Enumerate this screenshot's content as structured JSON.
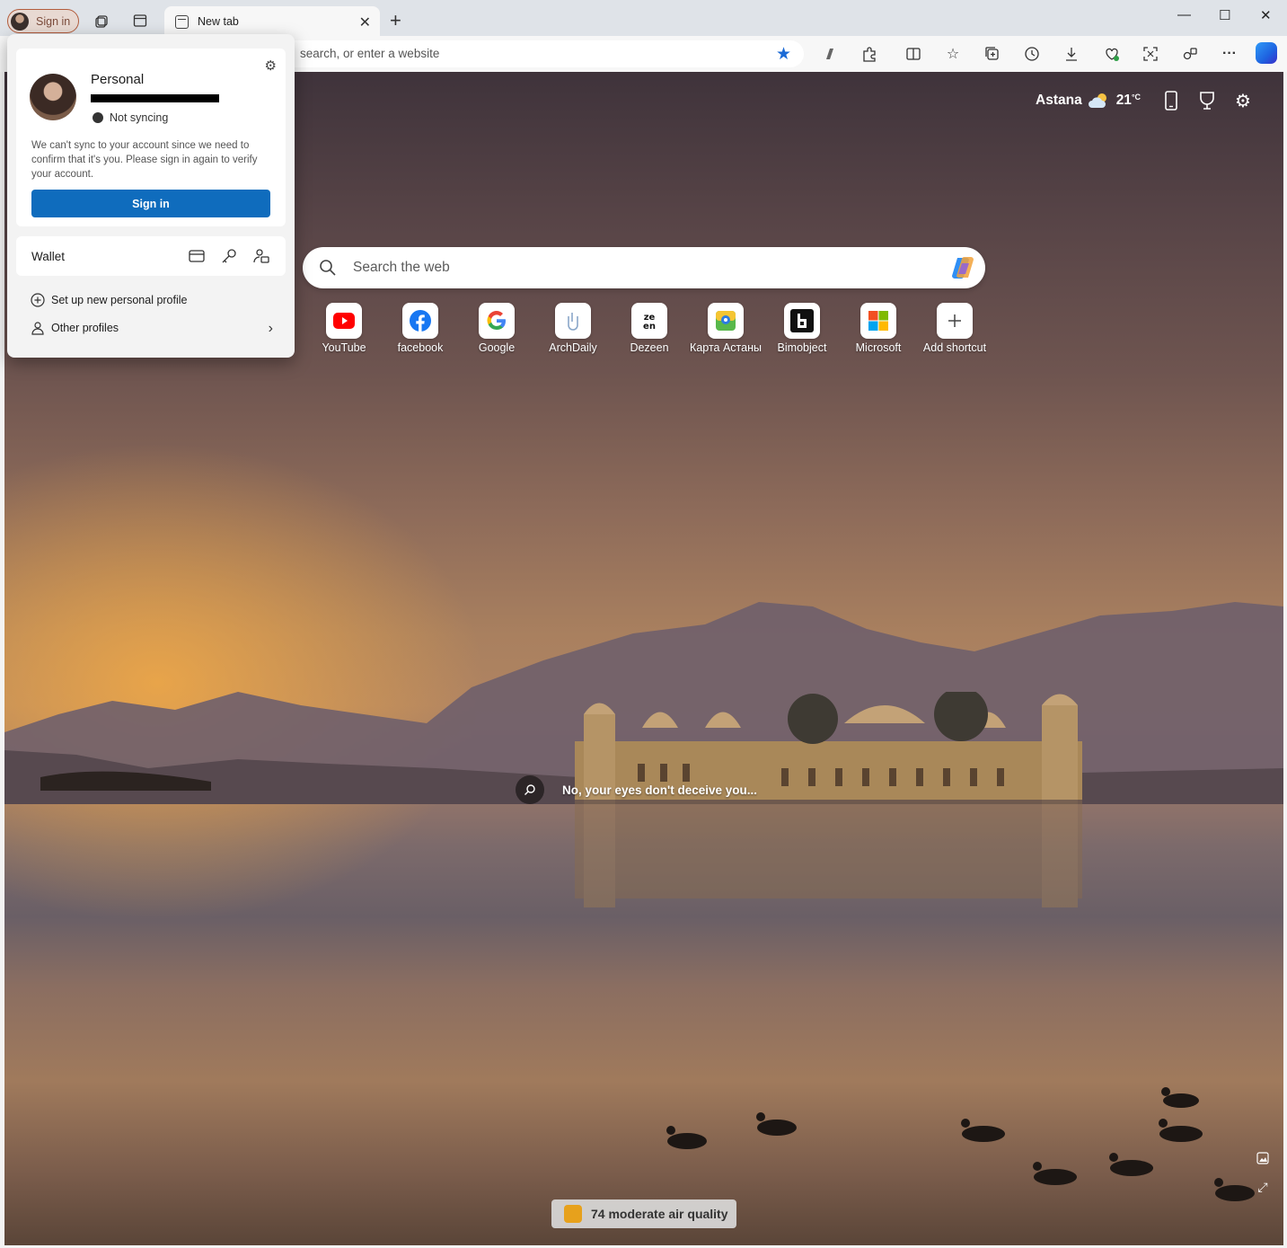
{
  "browser": {
    "signin_label": "Sign in",
    "tab_title": "New tab",
    "address_placeholder": "search, or enter a website"
  },
  "newtab": {
    "weather_city": "Astana",
    "weather_temp": "21",
    "weather_unit": "°C",
    "search_placeholder": "Search the web",
    "shortcuts": [
      {
        "label": "YouTube",
        "icon": "youtube-icon"
      },
      {
        "label": "facebook",
        "icon": "facebook-icon"
      },
      {
        "label": "Google",
        "icon": "google-icon"
      },
      {
        "label": "ArchDaily",
        "icon": "archdaily-icon"
      },
      {
        "label": "Dezeen",
        "icon": "dezeen-icon"
      },
      {
        "label": "Карта Астаны",
        "icon": "map-icon"
      },
      {
        "label": "Bimobject",
        "icon": "bimobject-icon"
      },
      {
        "label": "Microsoft",
        "icon": "microsoft-icon"
      },
      {
        "label": "Add shortcut",
        "icon": "plus-icon"
      }
    ],
    "image_caption": "No, your eyes don't deceive you...",
    "air_quality": "74 moderate air quality"
  },
  "profile": {
    "name": "Personal",
    "sync_status": "Not syncing",
    "message": "We can't sync to your account since we need to confirm that it's you. Please sign in again to verify your account.",
    "signin_button": "Sign in",
    "wallet_label": "Wallet",
    "setup_profile": "Set up new personal profile",
    "other_profiles": "Other profiles"
  },
  "colors": {
    "accent": "#0f6cbd",
    "signin_border": "#b25c3c"
  }
}
